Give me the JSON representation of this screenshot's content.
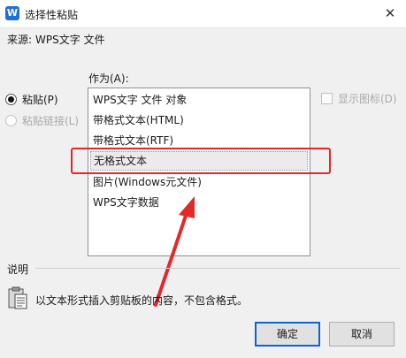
{
  "window": {
    "icon_letter": "W",
    "title": "选择性粘贴",
    "close_glyph": "✕"
  },
  "source": {
    "label": "来源:",
    "value": "WPS文字 文件"
  },
  "as_label": "作为(A):",
  "options": {
    "paste": "粘贴(P)",
    "paste_link": "粘贴链接(L)"
  },
  "list": {
    "items": [
      "WPS文字 文件 对象",
      "带格式文本(HTML)",
      "带格式文本(RTF)",
      "无格式文本",
      "图片(Windows元文件)",
      "WPS文字数据"
    ],
    "selected_index": 3
  },
  "display_as_icon": "显示图标(D)",
  "description": {
    "label": "说明",
    "text": "以文本形式插入剪贴板的内容，不包含格式。"
  },
  "buttons": {
    "ok": "确定",
    "cancel": "取消"
  },
  "colors": {
    "annotation_red": "#e52727",
    "accent_blue": "#0a64d6",
    "icon_blue": "#1e6fd9"
  }
}
